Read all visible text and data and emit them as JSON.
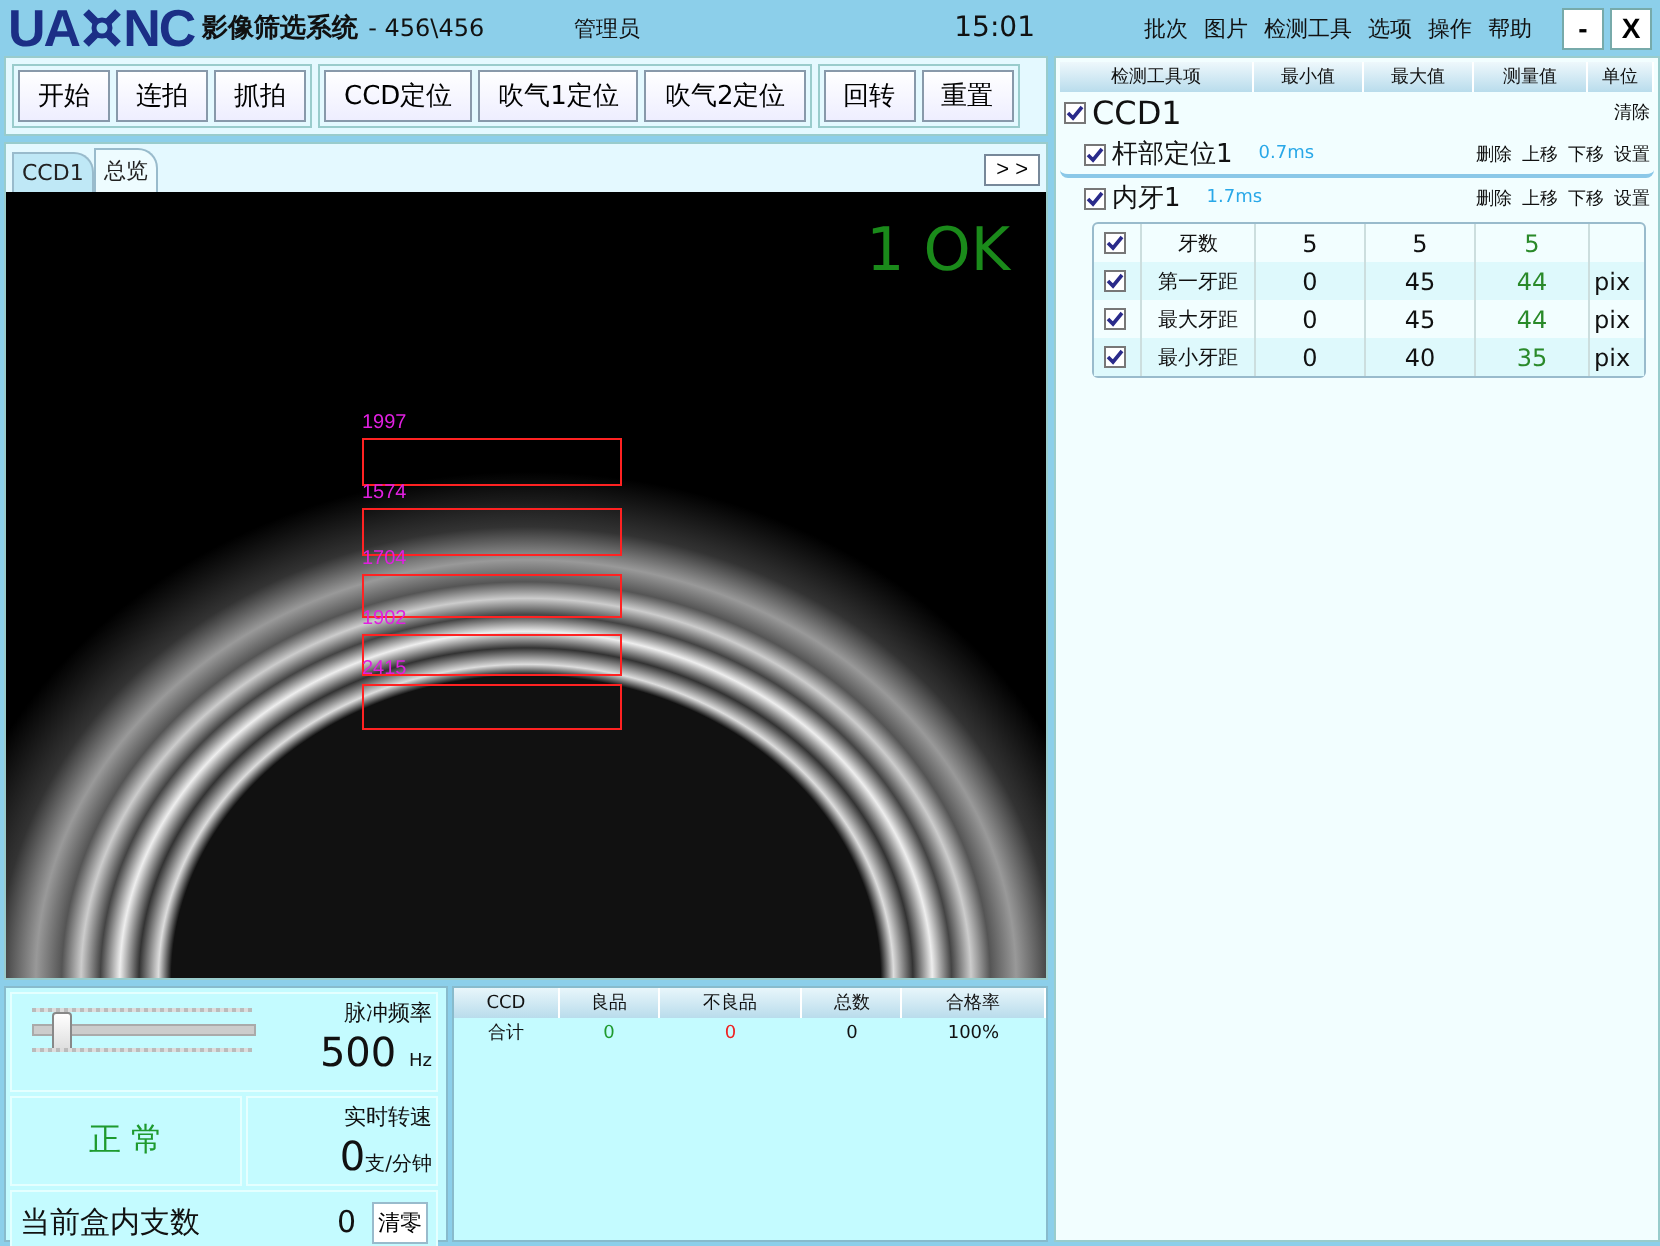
{
  "titlebar": {
    "logo_left": "UA",
    "logo_right": "NC",
    "title": "影像筛选系统",
    "subtitle": "- 456\\456",
    "user": "管理员",
    "time": "15:01",
    "menu": [
      "批次",
      "图片",
      "检测工具",
      "选项",
      "操作",
      "帮助"
    ],
    "window_buttons": [
      "-",
      "X"
    ]
  },
  "toolbar": [
    [
      "开始",
      "连拍",
      "抓拍"
    ],
    [
      "CCD定位",
      "吹气1定位",
      "吹气2定位"
    ],
    [
      "回转",
      "重置"
    ]
  ],
  "tabs": [
    {
      "label": "CCD1",
      "selected": true
    },
    {
      "label": "总览",
      "selected": false
    }
  ],
  "more_button": "> >",
  "camera": {
    "result": "1 OK",
    "rois": [
      {
        "label": "1997"
      },
      {
        "label": "1574"
      },
      {
        "label": "1704"
      },
      {
        "label": "1902"
      },
      {
        "label": "2415"
      }
    ]
  },
  "controls": {
    "slider": {
      "label": "脉冲频率",
      "level": 0.08,
      "value": "500",
      "unit": "Hz"
    },
    "status": "正 常",
    "speed": {
      "label": "实时转速",
      "value": "0",
      "unit": "支/分钟"
    },
    "box_count": {
      "label": "当前盒内支数",
      "value": "0",
      "button": "清零"
    }
  },
  "stats": {
    "columns": [
      "CCD",
      "良品",
      "不良品",
      "总数",
      "合格率"
    ],
    "rows": [
      [
        "合计",
        "0",
        "0",
        "0",
        "100%"
      ]
    ]
  },
  "tools_panel": {
    "columns": [
      "检测工具项",
      "最小值",
      "最大值",
      "测量值",
      "单位"
    ],
    "camera": {
      "label": "CCD1",
      "checked": true,
      "action": "清除"
    },
    "tools": [
      {
        "name": "杆部定位1",
        "checked": true,
        "selected": true,
        "time": "0.7ms",
        "actions": [
          "删除",
          "上移",
          "下移",
          "设置"
        ]
      },
      {
        "name": "内牙1",
        "checked": true,
        "selected": false,
        "time": "1.7ms",
        "actions": [
          "删除",
          "上移",
          "下移",
          "设置"
        ],
        "params": [
          {
            "checked": true,
            "name": "牙数",
            "min": "5",
            "max": "5",
            "value": "5"
          },
          {
            "checked": true,
            "name": "第一牙距",
            "min": "0",
            "max": "45",
            "value": "44",
            "unit": "pix"
          },
          {
            "checked": true,
            "name": "最大牙距",
            "min": "0",
            "max": "45",
            "value": "44",
            "unit": "pix"
          },
          {
            "checked": true,
            "name": "最小牙距",
            "min": "0",
            "max": "40",
            "value": "35",
            "unit": "pix"
          }
        ]
      }
    ]
  }
}
